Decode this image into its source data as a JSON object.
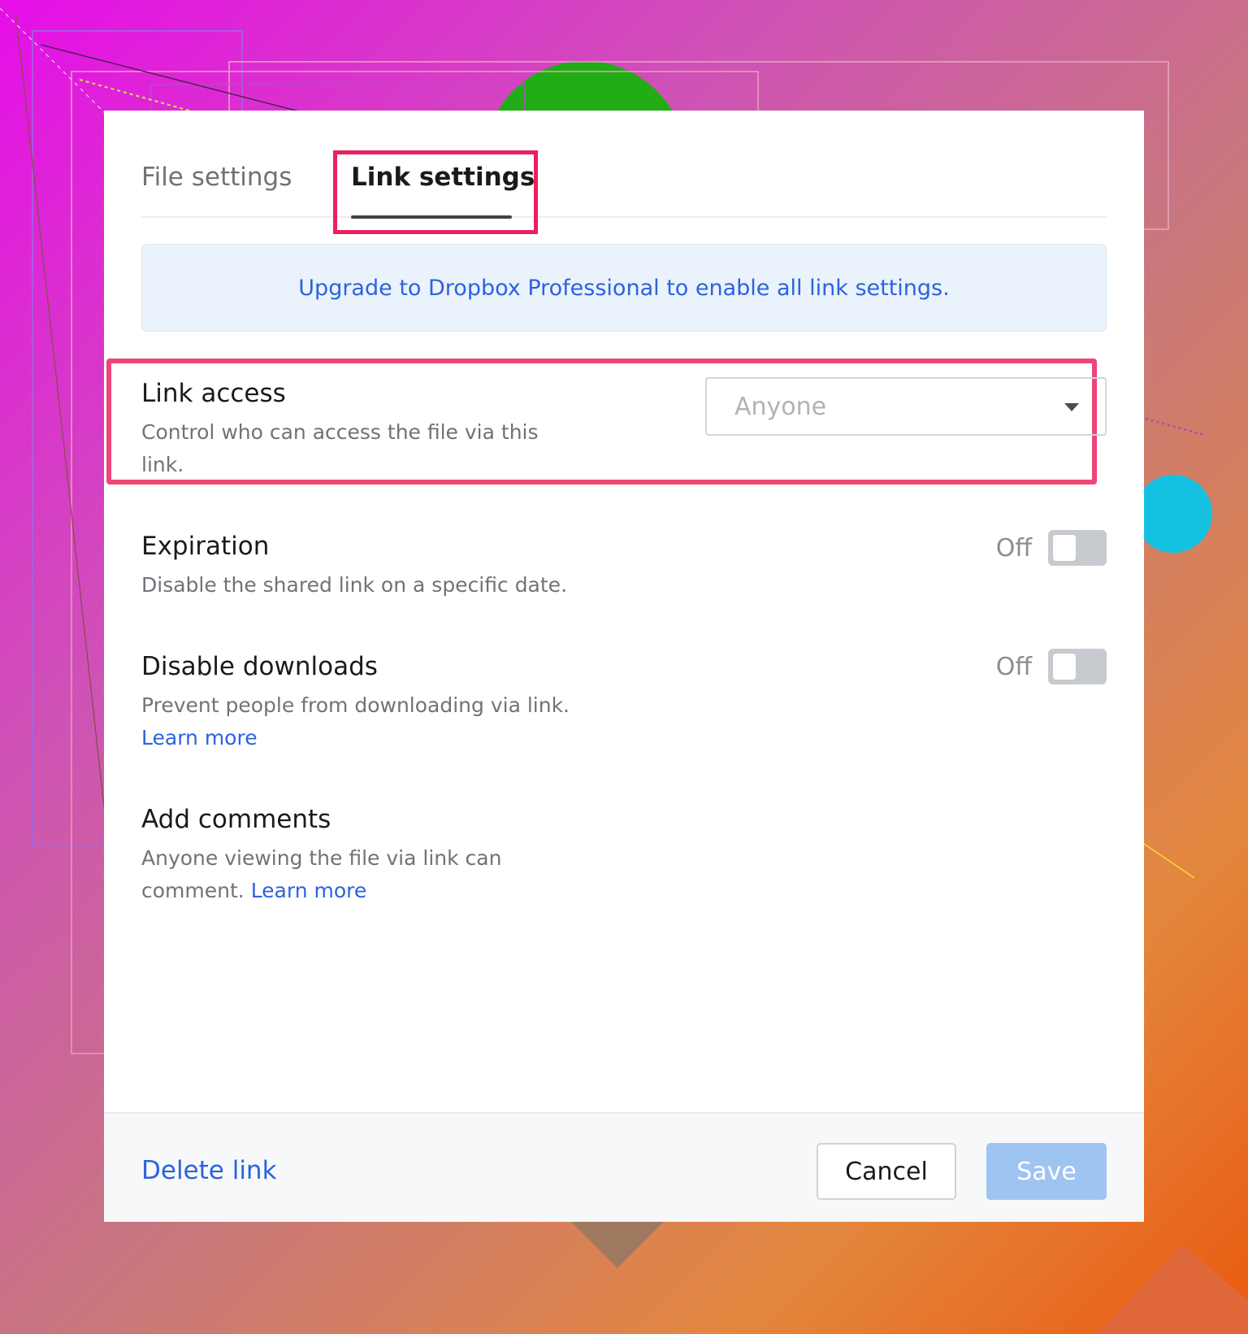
{
  "tabs": {
    "file_settings": "File settings",
    "link_settings": "Link settings"
  },
  "banner": {
    "text": "Upgrade to Dropbox Professional to enable all link settings."
  },
  "link_access": {
    "title": "Link access",
    "description": "Control who can access the file via this link.",
    "select_value": "Anyone"
  },
  "expiration": {
    "title": "Expiration",
    "description": "Disable the shared link on a specific date.",
    "toggle_state": "Off"
  },
  "disable_downloads": {
    "title": "Disable downloads",
    "description": "Prevent people from downloading via link.",
    "learn_more": "Learn more",
    "toggle_state": "Off"
  },
  "add_comments": {
    "title": "Add comments",
    "description": "Anyone viewing the file via link can comment.",
    "learn_more": "Learn more"
  },
  "footer": {
    "delete_link": "Delete link",
    "cancel": "Cancel",
    "save": "Save"
  },
  "colors": {
    "link_blue": "#2c63dd",
    "highlight": "#ee1f5d",
    "save_disabled": "#9ec4f2",
    "banner_bg": "#eaf2fb"
  },
  "icons": {
    "select_caret": "caret-down-icon"
  }
}
